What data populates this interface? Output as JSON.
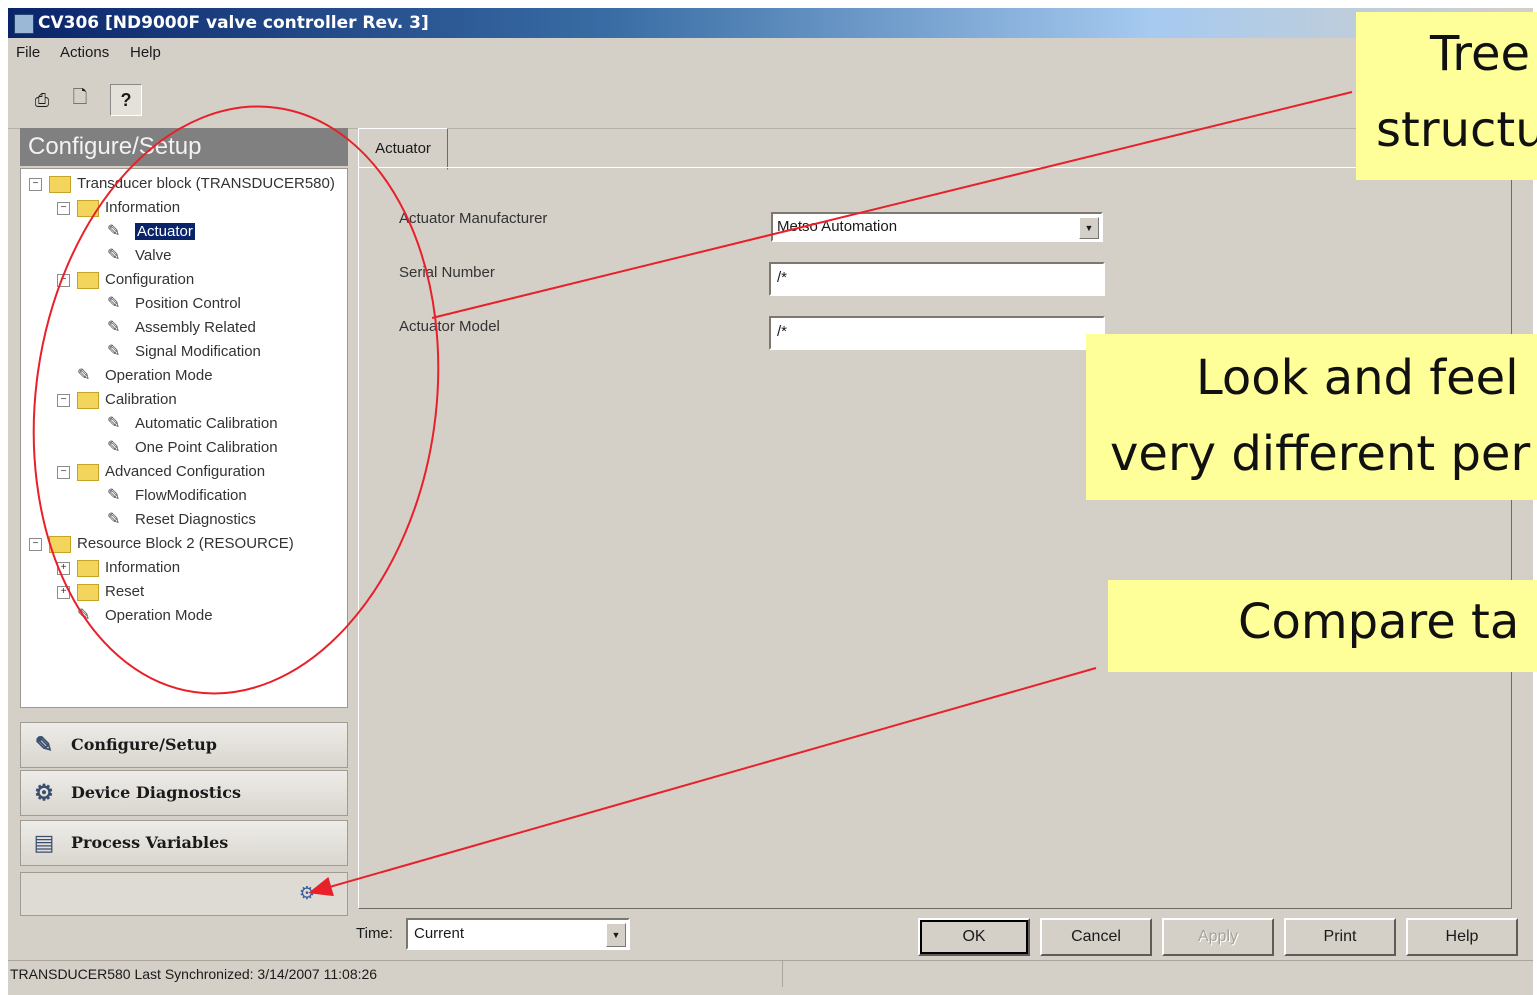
{
  "window": {
    "title": "CV306 [ND9000F valve controller Rev. 3]"
  },
  "menu": [
    "File",
    "Actions",
    "Help"
  ],
  "toolbar": {
    "buttons": [
      {
        "icon": "print-icon",
        "glyph": "⎙"
      },
      {
        "icon": "print-preview-icon",
        "glyph": "🗋"
      },
      {
        "icon": "context-help-icon",
        "glyph": "?"
      }
    ]
  },
  "left_panel": {
    "header": "Configure/Setup",
    "tree": [
      {
        "label": "Transducer block (TRANSDUCER580)",
        "type": "folder",
        "expander": "−"
      },
      {
        "label": "Information",
        "type": "folder",
        "expander": "−"
      },
      {
        "label": "Actuator",
        "type": "page",
        "selected": true
      },
      {
        "label": "Valve",
        "type": "page"
      },
      {
        "label": "Configuration",
        "type": "folder",
        "expander": "−"
      },
      {
        "label": "Position Control",
        "type": "page"
      },
      {
        "label": "Assembly Related",
        "type": "page"
      },
      {
        "label": "Signal Modification",
        "type": "page"
      },
      {
        "label": "Operation Mode",
        "type": "page"
      },
      {
        "label": "Calibration",
        "type": "folder",
        "expander": "−"
      },
      {
        "label": "Automatic Calibration",
        "type": "page"
      },
      {
        "label": "One Point Calibration",
        "type": "page"
      },
      {
        "label": "Advanced Configuration",
        "type": "folder",
        "expander": "−"
      },
      {
        "label": "FlowModification",
        "type": "page"
      },
      {
        "label": "Reset Diagnostics",
        "type": "page"
      },
      {
        "label": "Resource Block 2 (RESOURCE)",
        "type": "folder",
        "expander": "−"
      },
      {
        "label": "Information",
        "type": "folder",
        "expander": "+"
      },
      {
        "label": "Reset",
        "type": "folder",
        "expander": "+"
      },
      {
        "label": "Operation Mode",
        "type": "page"
      }
    ],
    "nav_buttons": [
      {
        "label": "Configure/Setup",
        "icon": "configure-icon",
        "glyph": "✎"
      },
      {
        "label": "Device Diagnostics",
        "icon": "diagnostics-icon",
        "glyph": "⚙"
      },
      {
        "label": "Process Variables",
        "icon": "process-variables-icon",
        "glyph": "▤"
      }
    ]
  },
  "tab": {
    "label": "Actuator"
  },
  "form": {
    "manufacturer_label": "Actuator Manufacturer",
    "manufacturer_value": "Metso Automation",
    "serial_label": "Serial Number",
    "serial_value": "/*",
    "model_label": "Actuator Model",
    "model_value": "/*"
  },
  "bottom": {
    "time_label": "Time:",
    "time_value": "Current",
    "buttons": [
      "OK",
      "Cancel",
      "Apply",
      "Print",
      "Help"
    ]
  },
  "status": {
    "text": "TRANSDUCER580 Last Synchronized: 3/14/2007 11:08:26"
  },
  "callouts": {
    "tree_line1": "Tree",
    "tree_line2": "structu",
    "look_line1": "Look and feel",
    "look_line2": "very different per",
    "compare": "Compare ta"
  },
  "colors": {
    "annotation": "#e8202a",
    "callout_bg": "#ffff99",
    "window_bg": "#d4d0c8",
    "selection": "#0a246a"
  }
}
